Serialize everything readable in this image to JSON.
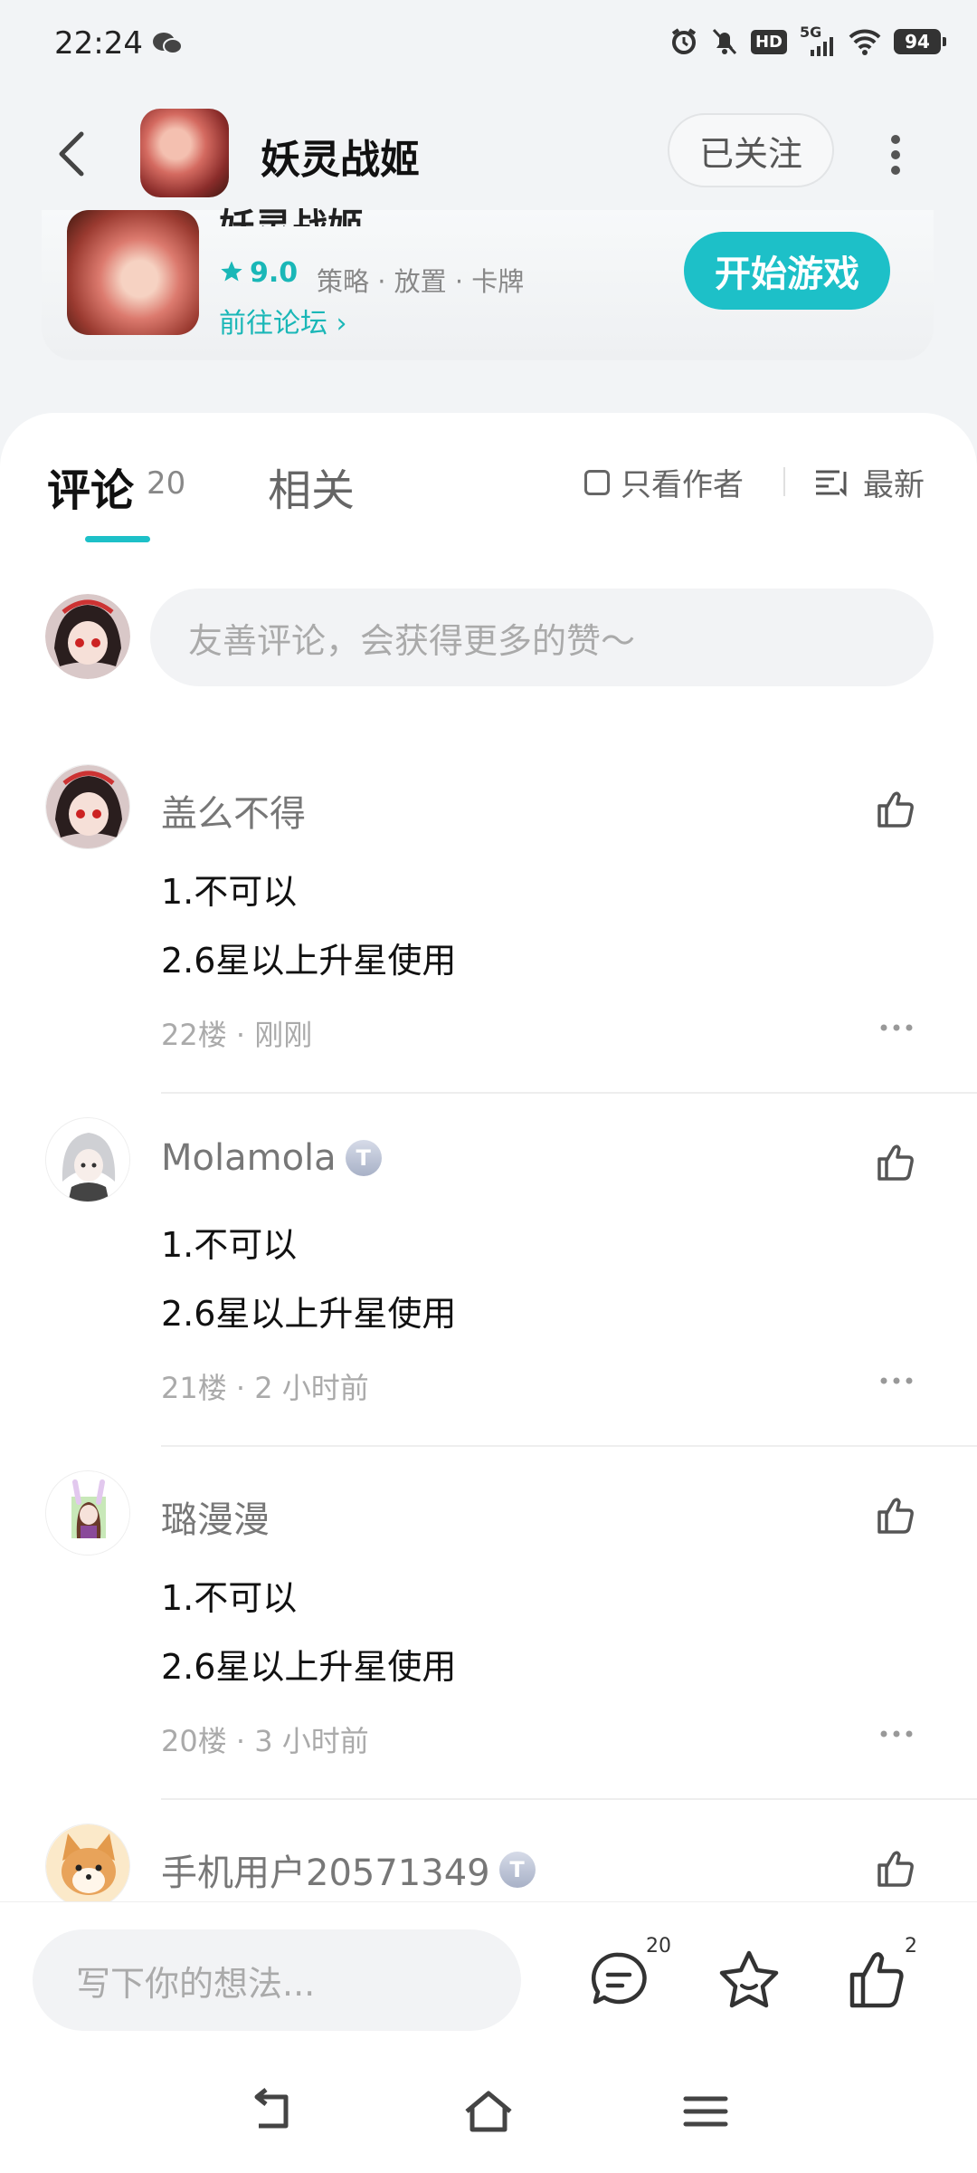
{
  "status_bar": {
    "time": "22:24",
    "battery": "94",
    "network": "5G",
    "hd": "HD"
  },
  "header": {
    "title": "妖灵战姬",
    "follow_label": "已关注"
  },
  "game_card": {
    "title": "妖灵战姬",
    "rating": "9.0",
    "tags": "策略 · 放置 · 卡牌",
    "forum_link": "前往论坛 ›",
    "start_label": "开始游戏"
  },
  "tabs": {
    "comments_label": "评论",
    "comments_count": "20",
    "related_label": "相关",
    "author_only_label": "只看作者",
    "sort_label": "最新"
  },
  "comment_input_placeholder": "友善评论，会获得更多的赞～",
  "comments": [
    {
      "name": "盖么不得",
      "badge": "",
      "line1": "1.不可以",
      "line2": "2.6星以上升星使用",
      "meta": "22楼 · 刚刚"
    },
    {
      "name": "Molamola",
      "badge": "T",
      "line1": "1.不可以",
      "line2": "2.6星以上升星使用",
      "meta": "21楼 · 2 小时前"
    },
    {
      "name": "璐漫漫",
      "badge": "",
      "line1": "1.不可以",
      "line2": "2.6星以上升星使用",
      "meta": "20楼 · 3 小时前"
    },
    {
      "name": "手机用户20571349",
      "badge": "T",
      "line1": "",
      "line2": "",
      "meta": ""
    }
  ],
  "bottom_bar": {
    "placeholder": "写下你的想法...",
    "comment_count": "20",
    "like_count": "2"
  },
  "colors": {
    "accent": "#1dc0c8",
    "accent_text": "#1ab7b7"
  }
}
